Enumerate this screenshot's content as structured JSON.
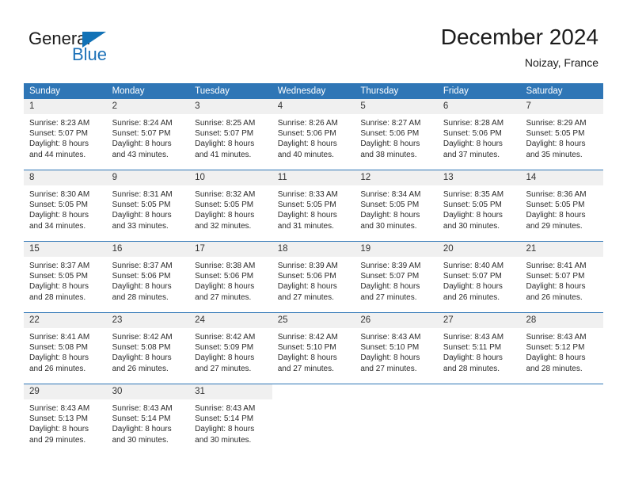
{
  "brand": {
    "name_part1": "General",
    "name_part2": "Blue",
    "accent_color": "#1272b6",
    "logo_icon": "triangle-flag-icon"
  },
  "header": {
    "month_title": "December 2024",
    "location": "Noizay, France"
  },
  "calendar": {
    "header_bg": "#2f76b6",
    "daynum_bg": "#f0f0f0",
    "weekdays": [
      "Sunday",
      "Monday",
      "Tuesday",
      "Wednesday",
      "Thursday",
      "Friday",
      "Saturday"
    ],
    "weeks": [
      [
        {
          "day": "1",
          "sunrise": "Sunrise: 8:23 AM",
          "sunset": "Sunset: 5:07 PM",
          "daylight_line1": "Daylight: 8 hours",
          "daylight_line2": "and 44 minutes."
        },
        {
          "day": "2",
          "sunrise": "Sunrise: 8:24 AM",
          "sunset": "Sunset: 5:07 PM",
          "daylight_line1": "Daylight: 8 hours",
          "daylight_line2": "and 43 minutes."
        },
        {
          "day": "3",
          "sunrise": "Sunrise: 8:25 AM",
          "sunset": "Sunset: 5:07 PM",
          "daylight_line1": "Daylight: 8 hours",
          "daylight_line2": "and 41 minutes."
        },
        {
          "day": "4",
          "sunrise": "Sunrise: 8:26 AM",
          "sunset": "Sunset: 5:06 PM",
          "daylight_line1": "Daylight: 8 hours",
          "daylight_line2": "and 40 minutes."
        },
        {
          "day": "5",
          "sunrise": "Sunrise: 8:27 AM",
          "sunset": "Sunset: 5:06 PM",
          "daylight_line1": "Daylight: 8 hours",
          "daylight_line2": "and 38 minutes."
        },
        {
          "day": "6",
          "sunrise": "Sunrise: 8:28 AM",
          "sunset": "Sunset: 5:06 PM",
          "daylight_line1": "Daylight: 8 hours",
          "daylight_line2": "and 37 minutes."
        },
        {
          "day": "7",
          "sunrise": "Sunrise: 8:29 AM",
          "sunset": "Sunset: 5:05 PM",
          "daylight_line1": "Daylight: 8 hours",
          "daylight_line2": "and 35 minutes."
        }
      ],
      [
        {
          "day": "8",
          "sunrise": "Sunrise: 8:30 AM",
          "sunset": "Sunset: 5:05 PM",
          "daylight_line1": "Daylight: 8 hours",
          "daylight_line2": "and 34 minutes."
        },
        {
          "day": "9",
          "sunrise": "Sunrise: 8:31 AM",
          "sunset": "Sunset: 5:05 PM",
          "daylight_line1": "Daylight: 8 hours",
          "daylight_line2": "and 33 minutes."
        },
        {
          "day": "10",
          "sunrise": "Sunrise: 8:32 AM",
          "sunset": "Sunset: 5:05 PM",
          "daylight_line1": "Daylight: 8 hours",
          "daylight_line2": "and 32 minutes."
        },
        {
          "day": "11",
          "sunrise": "Sunrise: 8:33 AM",
          "sunset": "Sunset: 5:05 PM",
          "daylight_line1": "Daylight: 8 hours",
          "daylight_line2": "and 31 minutes."
        },
        {
          "day": "12",
          "sunrise": "Sunrise: 8:34 AM",
          "sunset": "Sunset: 5:05 PM",
          "daylight_line1": "Daylight: 8 hours",
          "daylight_line2": "and 30 minutes."
        },
        {
          "day": "13",
          "sunrise": "Sunrise: 8:35 AM",
          "sunset": "Sunset: 5:05 PM",
          "daylight_line1": "Daylight: 8 hours",
          "daylight_line2": "and 30 minutes."
        },
        {
          "day": "14",
          "sunrise": "Sunrise: 8:36 AM",
          "sunset": "Sunset: 5:05 PM",
          "daylight_line1": "Daylight: 8 hours",
          "daylight_line2": "and 29 minutes."
        }
      ],
      [
        {
          "day": "15",
          "sunrise": "Sunrise: 8:37 AM",
          "sunset": "Sunset: 5:05 PM",
          "daylight_line1": "Daylight: 8 hours",
          "daylight_line2": "and 28 minutes."
        },
        {
          "day": "16",
          "sunrise": "Sunrise: 8:37 AM",
          "sunset": "Sunset: 5:06 PM",
          "daylight_line1": "Daylight: 8 hours",
          "daylight_line2": "and 28 minutes."
        },
        {
          "day": "17",
          "sunrise": "Sunrise: 8:38 AM",
          "sunset": "Sunset: 5:06 PM",
          "daylight_line1": "Daylight: 8 hours",
          "daylight_line2": "and 27 minutes."
        },
        {
          "day": "18",
          "sunrise": "Sunrise: 8:39 AM",
          "sunset": "Sunset: 5:06 PM",
          "daylight_line1": "Daylight: 8 hours",
          "daylight_line2": "and 27 minutes."
        },
        {
          "day": "19",
          "sunrise": "Sunrise: 8:39 AM",
          "sunset": "Sunset: 5:07 PM",
          "daylight_line1": "Daylight: 8 hours",
          "daylight_line2": "and 27 minutes."
        },
        {
          "day": "20",
          "sunrise": "Sunrise: 8:40 AM",
          "sunset": "Sunset: 5:07 PM",
          "daylight_line1": "Daylight: 8 hours",
          "daylight_line2": "and 26 minutes."
        },
        {
          "day": "21",
          "sunrise": "Sunrise: 8:41 AM",
          "sunset": "Sunset: 5:07 PM",
          "daylight_line1": "Daylight: 8 hours",
          "daylight_line2": "and 26 minutes."
        }
      ],
      [
        {
          "day": "22",
          "sunrise": "Sunrise: 8:41 AM",
          "sunset": "Sunset: 5:08 PM",
          "daylight_line1": "Daylight: 8 hours",
          "daylight_line2": "and 26 minutes."
        },
        {
          "day": "23",
          "sunrise": "Sunrise: 8:42 AM",
          "sunset": "Sunset: 5:08 PM",
          "daylight_line1": "Daylight: 8 hours",
          "daylight_line2": "and 26 minutes."
        },
        {
          "day": "24",
          "sunrise": "Sunrise: 8:42 AM",
          "sunset": "Sunset: 5:09 PM",
          "daylight_line1": "Daylight: 8 hours",
          "daylight_line2": "and 27 minutes."
        },
        {
          "day": "25",
          "sunrise": "Sunrise: 8:42 AM",
          "sunset": "Sunset: 5:10 PM",
          "daylight_line1": "Daylight: 8 hours",
          "daylight_line2": "and 27 minutes."
        },
        {
          "day": "26",
          "sunrise": "Sunrise: 8:43 AM",
          "sunset": "Sunset: 5:10 PM",
          "daylight_line1": "Daylight: 8 hours",
          "daylight_line2": "and 27 minutes."
        },
        {
          "day": "27",
          "sunrise": "Sunrise: 8:43 AM",
          "sunset": "Sunset: 5:11 PM",
          "daylight_line1": "Daylight: 8 hours",
          "daylight_line2": "and 28 minutes."
        },
        {
          "day": "28",
          "sunrise": "Sunrise: 8:43 AM",
          "sunset": "Sunset: 5:12 PM",
          "daylight_line1": "Daylight: 8 hours",
          "daylight_line2": "and 28 minutes."
        }
      ],
      [
        {
          "day": "29",
          "sunrise": "Sunrise: 8:43 AM",
          "sunset": "Sunset: 5:13 PM",
          "daylight_line1": "Daylight: 8 hours",
          "daylight_line2": "and 29 minutes."
        },
        {
          "day": "30",
          "sunrise": "Sunrise: 8:43 AM",
          "sunset": "Sunset: 5:14 PM",
          "daylight_line1": "Daylight: 8 hours",
          "daylight_line2": "and 30 minutes."
        },
        {
          "day": "31",
          "sunrise": "Sunrise: 8:43 AM",
          "sunset": "Sunset: 5:14 PM",
          "daylight_line1": "Daylight: 8 hours",
          "daylight_line2": "and 30 minutes."
        },
        {
          "day": "",
          "sunrise": "",
          "sunset": "",
          "daylight_line1": "",
          "daylight_line2": ""
        },
        {
          "day": "",
          "sunrise": "",
          "sunset": "",
          "daylight_line1": "",
          "daylight_line2": ""
        },
        {
          "day": "",
          "sunrise": "",
          "sunset": "",
          "daylight_line1": "",
          "daylight_line2": ""
        },
        {
          "day": "",
          "sunrise": "",
          "sunset": "",
          "daylight_line1": "",
          "daylight_line2": ""
        }
      ]
    ]
  }
}
